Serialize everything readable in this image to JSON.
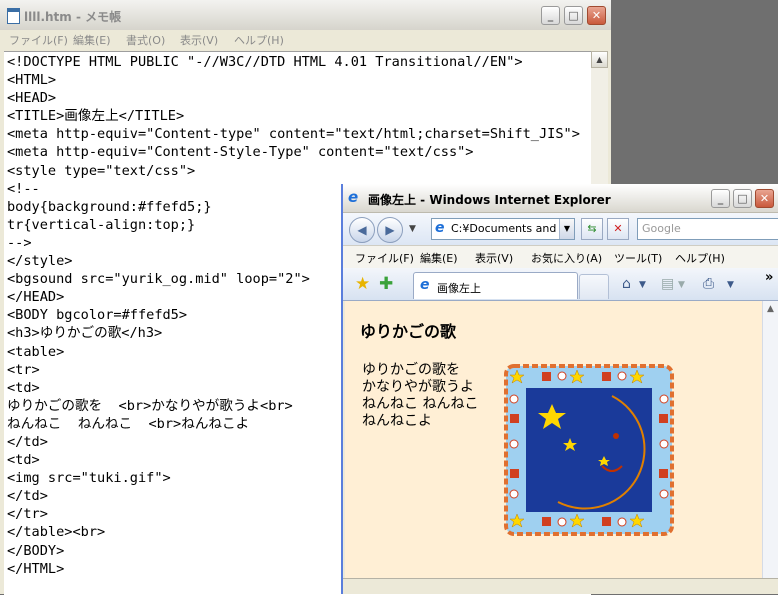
{
  "notepad": {
    "title": "llll.htm - メモ帳",
    "menu": [
      "ファイル(F)",
      "編集(E)",
      "書式(O)",
      "表示(V)",
      "ヘルプ(H)"
    ],
    "lines": [
      "<!DOCTYPE HTML PUBLIC \"-//W3C//DTD HTML 4.01 Transitional//EN\">",
      "<HTML>",
      "<HEAD>",
      "<TITLE>画像左上</TITLE>",
      "<meta http-equiv=\"Content-type\" content=\"text/html;charset=Shift_JIS\">",
      "<meta http-equiv=\"Content-Style-Type\" content=\"text/css\">",
      "<style type=\"text/css\">",
      "<!--",
      "body{background:#ffefd5;}",
      "tr{vertical-align:top;}",
      "-->",
      "</style>",
      "<bgsound src=\"yurik_og.mid\" loop=\"2\">",
      "</HEAD>",
      "<BODY bgcolor=#ffefd5>",
      "<h3>ゆりかごの歌</h3>",
      "<table>",
      "<tr>",
      "<td>",
      "ゆりかごの歌を  <br>かなりやが歌うよ<br>",
      "ねんねこ  ねんねこ  <br>ねんねこよ",
      "</td>",
      "<td>",
      "<img src=\"tuki.gif\">",
      "</td>",
      "</tr>",
      "</table><br>",
      "</BODY>",
      "</HTML>"
    ]
  },
  "browser": {
    "title": "画像左上 - Windows Internet Explorer",
    "address": "C:¥Documents and S",
    "search_placeholder": "Google",
    "menu": [
      "ファイル(F)",
      "編集(E)",
      "表示(V)",
      "お気に入り(A)",
      "ツール(T)",
      "ヘルプ(H)"
    ],
    "tab_label": "画像左上",
    "page": {
      "heading": "ゆりかごの歌",
      "lyrics": [
        "ゆりかごの歌を",
        "かなりやが歌うよ",
        "ねんねこ ねんねこ",
        "ねんねこよ"
      ]
    }
  },
  "colors": {
    "page_bg": "#ffefd5",
    "moon": "#ffd700",
    "sky": "#1a3a9a",
    "frame": "#9fd0f0"
  }
}
